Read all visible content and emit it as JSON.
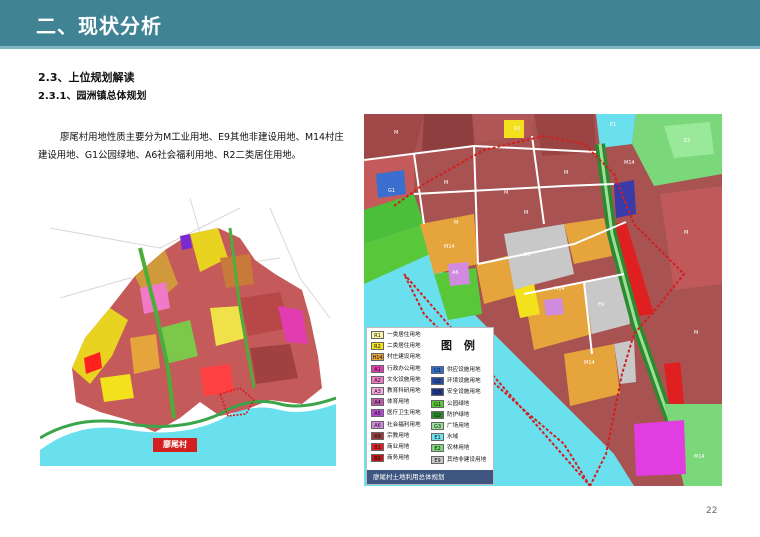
{
  "header": {
    "title": "二、现状分析"
  },
  "section": {
    "title": "2.3、上位规划解读",
    "subtitle": "2.3.1、园洲镇总体规划"
  },
  "body_text": "廖尾村用地性质主要分为M工业用地、E9其他非建设用地、M14村庄建设用地、G1公园绿地、A6社会福利用地、R2二类居住用地。",
  "left_map": {
    "village_tag": "廖尾村"
  },
  "right_map": {
    "legend_heading": "图 例",
    "legend_footer": "廖尾村土地利用总体规划",
    "legend_left": [
      {
        "code": "R1",
        "label": "一类居住用地",
        "color": "#fff7a8"
      },
      {
        "code": "R2",
        "label": "二类居住用地",
        "color": "#f2e11c"
      },
      {
        "code": "H14",
        "label": "村庄建设用地",
        "color": "#e6a53c"
      },
      {
        "code": "A1",
        "label": "行政办公用地",
        "color": "#e23db0"
      },
      {
        "code": "A2",
        "label": "文化设施用地",
        "color": "#f07ac8"
      },
      {
        "code": "A3",
        "label": "教育科研用地",
        "color": "#f7a8dc"
      },
      {
        "code": "A4",
        "label": "体育用地",
        "color": "#c25ab0"
      },
      {
        "code": "A5",
        "label": "医疗卫生用地",
        "color": "#b44ad0"
      },
      {
        "code": "A6",
        "label": "社会福利用地",
        "color": "#d08ae0"
      },
      {
        "code": "A9",
        "label": "宗教用地",
        "color": "#9a3a3a"
      },
      {
        "code": "B1",
        "label": "商业用地",
        "color": "#e02020"
      },
      {
        "code": "B2",
        "label": "商务用地",
        "color": "#c01818"
      }
    ],
    "legend_right": [
      {
        "code": "U1",
        "label": "供应设施用地",
        "color": "#2f6fc8"
      },
      {
        "code": "U2",
        "label": "环境设施用地",
        "color": "#2a4fa8"
      },
      {
        "code": "U3",
        "label": "安全设施用地",
        "color": "#203a88"
      },
      {
        "code": "G1",
        "label": "公园绿地",
        "color": "#58c83a"
      },
      {
        "code": "G2",
        "label": "防护绿地",
        "color": "#2e8a2e"
      },
      {
        "code": "G3",
        "label": "广场用地",
        "color": "#9adf9a"
      },
      {
        "code": "E1",
        "label": "水域",
        "color": "#6fe2f0"
      },
      {
        "code": "E2",
        "label": "农林用地",
        "color": "#7ad87a"
      },
      {
        "code": "E9",
        "label": "其他非建设用地",
        "color": "#c8c8c8"
      }
    ],
    "labels": [
      "M",
      "M",
      "M",
      "M",
      "M",
      "M",
      "M",
      "M",
      "M14",
      "M14",
      "M14",
      "M14",
      "R2",
      "E9",
      "E9",
      "G1",
      "A6",
      "E2",
      "E1",
      "M14"
    ]
  },
  "page": {
    "number": "22"
  }
}
